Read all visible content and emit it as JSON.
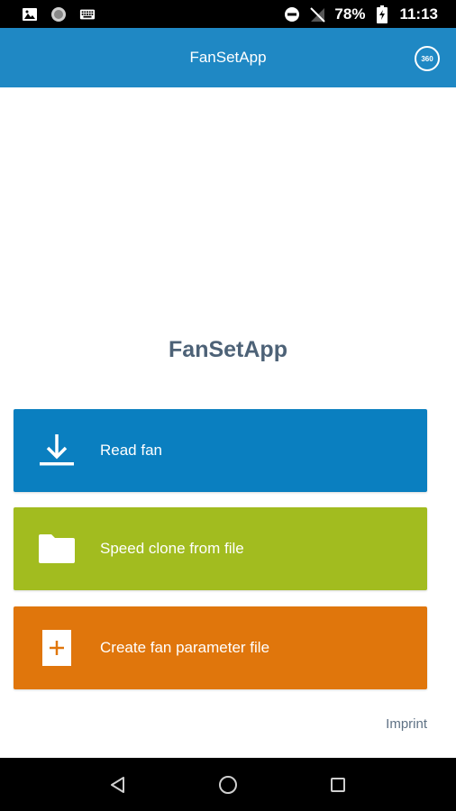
{
  "status_bar": {
    "battery_percent": "78%",
    "time": "11:13",
    "icons": [
      "image-icon",
      "circle-icon",
      "keyboard-icon",
      "do-not-disturb-icon",
      "no-signal-icon",
      "battery-charging-icon"
    ]
  },
  "app_bar": {
    "title": "FanSetApp",
    "action_icon_text": "360",
    "color": "#1f88c4"
  },
  "main": {
    "title": "FanSetApp",
    "buttons": [
      {
        "label": "Read fan",
        "icon": "download-icon",
        "color": "#0a7fc0"
      },
      {
        "label": "Speed clone from file",
        "icon": "folder-icon",
        "color": "#a2bc1f"
      },
      {
        "label": "Create fan parameter file",
        "icon": "add-file-icon",
        "color": "#e0760c"
      }
    ],
    "imprint": "Imprint"
  },
  "nav_bar": {
    "items": [
      "back-icon",
      "home-icon",
      "recents-icon"
    ]
  }
}
